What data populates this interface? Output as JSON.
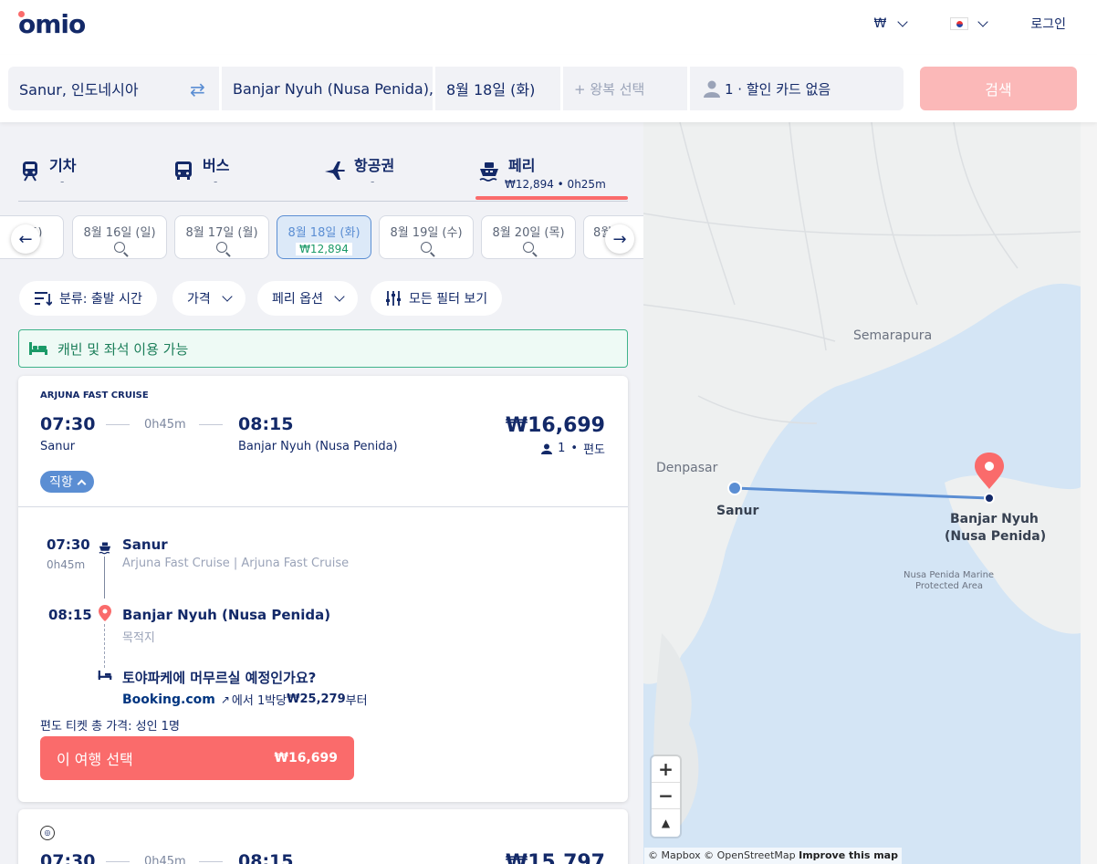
{
  "header": {
    "logo": "omio",
    "currency": "₩",
    "login": "로그인"
  },
  "search": {
    "from": "Sanur, 인도네시아",
    "to": "Banjar Nyuh (Nusa Penida),",
    "date": "8월 18일 (화)",
    "return_placeholder": "+ 왕복 선택",
    "passengers": "1 · 할인 카드 없음",
    "search_label": "검색"
  },
  "modes": [
    {
      "label": "기차",
      "sub": "-"
    },
    {
      "label": "버스",
      "sub": "-"
    },
    {
      "label": "항공권",
      "sub": "-"
    },
    {
      "label": "페리",
      "sub": "₩12,894 • 0h25m"
    }
  ],
  "dates": [
    {
      "label": "토)"
    },
    {
      "label": "8월 16일 (일)"
    },
    {
      "label": "8월 17일 (월)"
    },
    {
      "label": "8월 18일 (화)",
      "price": "₩12,894"
    },
    {
      "label": "8월 19일 (수)"
    },
    {
      "label": "8월 20일 (목)"
    },
    {
      "label": "8월"
    }
  ],
  "filters": {
    "sort": "분류: 출발 시간",
    "price": "가격",
    "ferry_options": "페리 옵션",
    "all_filters": "모든 필터 보기"
  },
  "banner": "캐빈 및 좌석 이용 가능",
  "result": {
    "operator": "ARJUNA FAST CRUISE",
    "depart_time": "07:30",
    "duration": "0h45m",
    "arrive_time": "08:15",
    "depart_place": "Sanur",
    "arrive_place": "Banjar Nyuh (Nusa Penida)",
    "price": "₩16,699",
    "pax": "1",
    "trip_type": "편도",
    "direct": "직항",
    "detail": {
      "dep_time": "07:30",
      "dep_dur": "0h45m",
      "dep_name": "Sanur",
      "dep_company": "Arjuna Fast Cruise | Arjuna Fast Cruise",
      "arr_time": "08:15",
      "arr_name": "Banjar Nyuh (Nusa Penida)",
      "arr_sub": "목적지",
      "hotel_q": "토야파케에 머무르실 예정인가요?",
      "booking": "Booking.com",
      "hotel_price_prefix": "에서 1박당 ",
      "hotel_price": "₩25,279",
      "hotel_price_suffix": "부터"
    },
    "total_label": "편도 티켓 총 가격: 성인 1명",
    "select_label": "이 여행 선택",
    "select_price": "₩16,699"
  },
  "result2": {
    "depart_time": "07:30",
    "duration": "0h45m",
    "arrive_time": "08:15",
    "price": "₩15,797"
  },
  "map": {
    "labels": {
      "semarapura": "Semarapura",
      "denpasar": "Denpasar",
      "sanur": "Sanur",
      "banjar1": "Banjar Nyuh",
      "banjar2": "(Nusa Penida)",
      "marine1": "Nusa Penida Marine",
      "marine2": "Protected Area"
    },
    "zoom_in": "+",
    "zoom_out": "−",
    "compass": "▲",
    "attribution": "© Mapbox © OpenStreetMap",
    "improve": "Improve this map"
  },
  "colors": {
    "brand": "#132968",
    "accent": "#fa6b6b",
    "blue": "#5b8ed3",
    "green": "#1b9a68"
  }
}
